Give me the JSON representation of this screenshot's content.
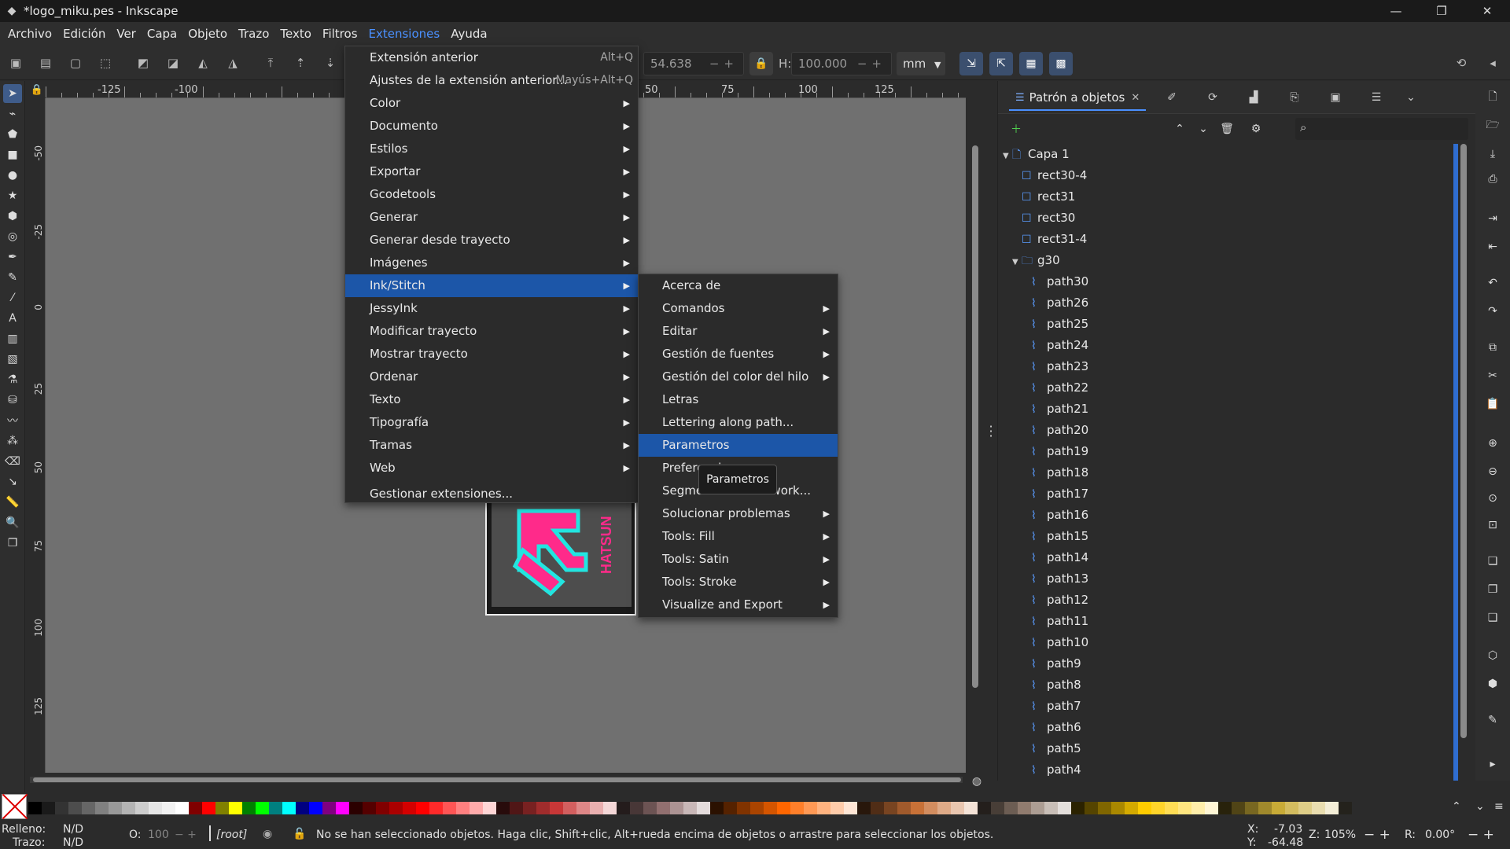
{
  "titlebar": {
    "title": "*logo_miku.pes - Inkscape",
    "minimize": "—",
    "maximize": "❐",
    "close": "✕"
  },
  "menubar": {
    "items": [
      "Archivo",
      "Edición",
      "Ver",
      "Capa",
      "Objeto",
      "Trazo",
      "Texto",
      "Filtros",
      "Extensiones",
      "Ayuda"
    ],
    "active": "Extensiones"
  },
  "toolctrl": {
    "w_value": "54.638",
    "h_label": "H:",
    "h_value": "100.000",
    "unit": "mm"
  },
  "rulers": {
    "h_ticks": [
      "-125",
      "-100",
      "50",
      "75",
      "100",
      "125"
    ],
    "v_ticks": [
      "-50",
      "-25",
      "0",
      "25",
      "50",
      "75",
      "100",
      "125"
    ]
  },
  "extensions_menu": {
    "items": [
      {
        "label": "Extensión anterior",
        "shortcut": "Alt+Q",
        "submenu": false
      },
      {
        "label": "Ajustes de la extensión anterior...",
        "shortcut": "Mayús+Alt+Q",
        "submenu": false
      },
      {
        "label": "Color",
        "shortcut": "",
        "submenu": true
      },
      {
        "label": "Documento",
        "shortcut": "",
        "submenu": true
      },
      {
        "label": "Estilos",
        "shortcut": "",
        "submenu": true
      },
      {
        "label": "Exportar",
        "shortcut": "",
        "submenu": true
      },
      {
        "label": "Gcodetools",
        "shortcut": "",
        "submenu": true
      },
      {
        "label": "Generar",
        "shortcut": "",
        "submenu": true
      },
      {
        "label": "Generar desde trayecto",
        "shortcut": "",
        "submenu": true
      },
      {
        "label": "Imágenes",
        "shortcut": "",
        "submenu": true
      },
      {
        "label": "Ink/Stitch",
        "shortcut": "",
        "submenu": true
      },
      {
        "label": "JessyInk",
        "shortcut": "",
        "submenu": true
      },
      {
        "label": "Modificar trayecto",
        "shortcut": "",
        "submenu": true
      },
      {
        "label": "Mostrar trayecto",
        "shortcut": "",
        "submenu": true
      },
      {
        "label": "Ordenar",
        "shortcut": "",
        "submenu": true
      },
      {
        "label": "Texto",
        "shortcut": "",
        "submenu": true
      },
      {
        "label": "Tipografía",
        "shortcut": "",
        "submenu": true
      },
      {
        "label": "Tramas",
        "shortcut": "",
        "submenu": true
      },
      {
        "label": "Web",
        "shortcut": "",
        "submenu": true
      },
      {
        "label": "Gestionar extensiones...",
        "shortcut": "",
        "submenu": false
      }
    ],
    "highlighted": "Ink/Stitch"
  },
  "inkstitch_submenu": {
    "items": [
      {
        "label": "Acerca de",
        "submenu": false
      },
      {
        "label": "Comandos",
        "submenu": true
      },
      {
        "label": "Editar",
        "submenu": true
      },
      {
        "label": "Gestión de fuentes",
        "submenu": true
      },
      {
        "label": "Gestión del color del hilo",
        "submenu": true
      },
      {
        "label": "Letras",
        "submenu": false
      },
      {
        "label": "Lettering along path...",
        "submenu": false
      },
      {
        "label": "Parametros",
        "submenu": false
      },
      {
        "label": "Preferencias",
        "submenu": false
      },
      {
        "label": "Segmentación Cutwork...",
        "submenu": false
      },
      {
        "label": "Solucionar problemas",
        "submenu": true
      },
      {
        "label": "Tools: Fill",
        "submenu": true
      },
      {
        "label": "Tools: Satin",
        "submenu": true
      },
      {
        "label": "Tools: Stroke",
        "submenu": true
      },
      {
        "label": "Visualize and Export",
        "submenu": true
      }
    ],
    "highlighted": "Parametros"
  },
  "tooltip": "Parametros",
  "artwork": {
    "label": "HATSUN"
  },
  "dock": {
    "tab_label": "Patrón a objetos",
    "tree": [
      {
        "label": "Capa 1",
        "kind": "layer",
        "depth": 0,
        "expanded": true
      },
      {
        "label": "rect30-4",
        "kind": "rect",
        "depth": 1
      },
      {
        "label": "rect31",
        "kind": "rect",
        "depth": 1
      },
      {
        "label": "rect30",
        "kind": "rect",
        "depth": 1
      },
      {
        "label": "rect31-4",
        "kind": "rect",
        "depth": 1
      },
      {
        "label": "g30",
        "kind": "group",
        "depth": 1,
        "expanded": true
      },
      {
        "label": "path30",
        "kind": "path",
        "depth": 2
      },
      {
        "label": "path26",
        "kind": "path",
        "depth": 2
      },
      {
        "label": "path25",
        "kind": "path",
        "depth": 2
      },
      {
        "label": "path24",
        "kind": "path",
        "depth": 2
      },
      {
        "label": "path23",
        "kind": "path",
        "depth": 2
      },
      {
        "label": "path22",
        "kind": "path",
        "depth": 2
      },
      {
        "label": "path21",
        "kind": "path",
        "depth": 2
      },
      {
        "label": "path20",
        "kind": "path",
        "depth": 2
      },
      {
        "label": "path19",
        "kind": "path",
        "depth": 2
      },
      {
        "label": "path18",
        "kind": "path",
        "depth": 2
      },
      {
        "label": "path17",
        "kind": "path",
        "depth": 2
      },
      {
        "label": "path16",
        "kind": "path",
        "depth": 2
      },
      {
        "label": "path15",
        "kind": "path",
        "depth": 2
      },
      {
        "label": "path14",
        "kind": "path",
        "depth": 2
      },
      {
        "label": "path13",
        "kind": "path",
        "depth": 2
      },
      {
        "label": "path12",
        "kind": "path",
        "depth": 2
      },
      {
        "label": "path11",
        "kind": "path",
        "depth": 2
      },
      {
        "label": "path10",
        "kind": "path",
        "depth": 2
      },
      {
        "label": "path9",
        "kind": "path",
        "depth": 2
      },
      {
        "label": "path8",
        "kind": "path",
        "depth": 2
      },
      {
        "label": "path7",
        "kind": "path",
        "depth": 2
      },
      {
        "label": "path6",
        "kind": "path",
        "depth": 2
      },
      {
        "label": "path5",
        "kind": "path",
        "depth": 2
      },
      {
        "label": "path4",
        "kind": "path",
        "depth": 2
      }
    ]
  },
  "palette": {
    "colors": [
      "#000000",
      "#1a1a1a",
      "#333333",
      "#4d4d4d",
      "#666666",
      "#808080",
      "#999999",
      "#b3b3b3",
      "#cccccc",
      "#e6e6e6",
      "#f2f2f2",
      "#ffffff",
      "#800000",
      "#ff0000",
      "#808000",
      "#ffff00",
      "#008000",
      "#00ff00",
      "#008080",
      "#00ffff",
      "#000080",
      "#0000ff",
      "#800080",
      "#ff00ff",
      "#2b0000",
      "#550000",
      "#800000",
      "#aa0000",
      "#d40000",
      "#ff0000",
      "#ff2a2a",
      "#ff5555",
      "#ff8080",
      "#ffaaaa",
      "#ffd5d5",
      "#280b0b",
      "#501616",
      "#782121",
      "#a02c2c",
      "#c83737",
      "#d35f5f",
      "#de8787",
      "#e9afaf",
      "#f4d7d7",
      "#241c1c",
      "#483737",
      "#6c5353",
      "#916f6f",
      "#ac9393",
      "#c8b7b7",
      "#e3dbdb",
      "#2b1100",
      "#552200",
      "#803300",
      "#aa4400",
      "#d45500",
      "#ff6600",
      "#ff7f2a",
      "#ff9955",
      "#ffb380",
      "#ffccaa",
      "#ffe6d5",
      "#28170b",
      "#502d16",
      "#784421",
      "#a05a2c",
      "#c87137",
      "#d38d5f",
      "#deaa87",
      "#e9c6af",
      "#f4e3d7",
      "#241f1c",
      "#483e37",
      "#6c5d53",
      "#917c6f",
      "#ac9d93",
      "#c8beb7",
      "#e3dedb",
      "#2b2200",
      "#554400",
      "#806600",
      "#aa8800",
      "#d4aa00",
      "#ffcc00",
      "#ffd42a",
      "#ffdd55",
      "#ffe680",
      "#ffeeaa",
      "#fff6d5",
      "#28220b",
      "#504416",
      "#786721",
      "#a0892c",
      "#c8ab37",
      "#d3bc5f",
      "#decd87",
      "#e9ddaf",
      "#f4eed7",
      "#24221c"
    ],
    "scroll_up": "⌃",
    "scroll_down": "⌄",
    "menu": "≡"
  },
  "statusbar": {
    "fill_label": "Relleno:",
    "fill_value": "N/D",
    "stroke_label": "Trazo:",
    "stroke_value": "N/D",
    "opacity_label": "O:",
    "opacity_value": "100",
    "layer": "[root]",
    "message": "No se han seleccionado objetos. Haga clic, Shift+clic, Alt+rueda encima de objetos o arrastre para seleccionar los objetos.",
    "x_label": "X:",
    "x_value": "-7.03",
    "y_label": "Y:",
    "y_value": "-64.48",
    "zoom_label": "Z:",
    "zoom_value": "105%",
    "rotation_label": "R:",
    "rotation_value": "0.00°"
  }
}
